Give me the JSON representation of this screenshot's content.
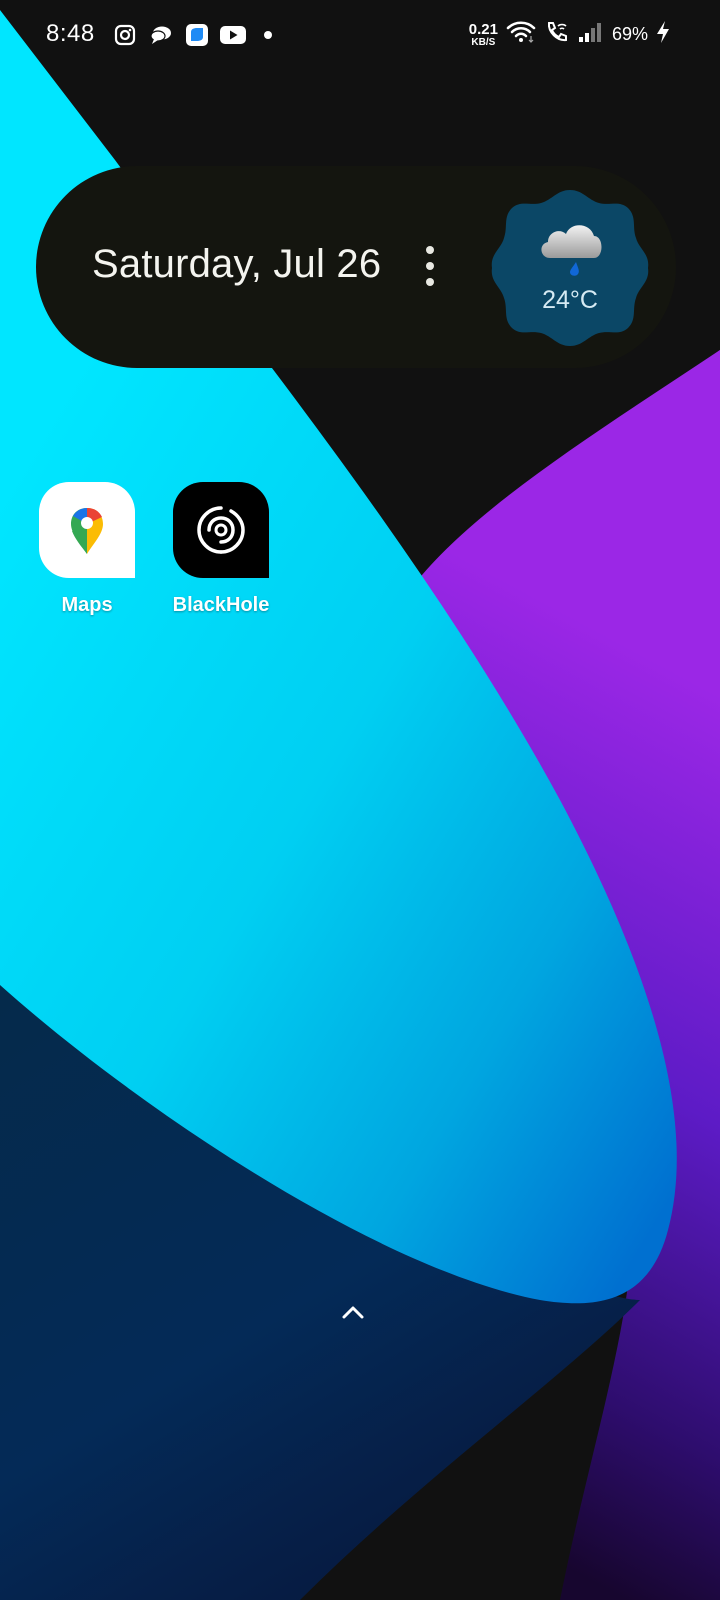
{
  "status_bar": {
    "time": "8:48",
    "notification_icons": [
      "instagram-icon",
      "chat-bubbles-icon",
      "app-tile-icon",
      "youtube-icon",
      "more-notifications-dot"
    ],
    "net_speed_value": "0.21",
    "net_speed_unit": "KB/S",
    "battery_percent": "69%",
    "charging": true
  },
  "widget": {
    "date": "Saturday, Jul 26",
    "weather_temp": "24°C",
    "weather_condition_icon": "cloud-rain-icon",
    "menu_icon": "more-vertical-icon"
  },
  "apps": [
    {
      "label": "Maps",
      "icon": "google-maps-icon"
    },
    {
      "label": "BlackHole",
      "icon": "blackhole-icon"
    }
  ],
  "drawer": {
    "icon": "chevron-up-icon"
  },
  "colors": {
    "cyan": "#00E5FF",
    "purple": "#7A1FD6",
    "navy": "#032A52",
    "widget_bg": "#14150F",
    "weather_badge": "#0B4766"
  }
}
